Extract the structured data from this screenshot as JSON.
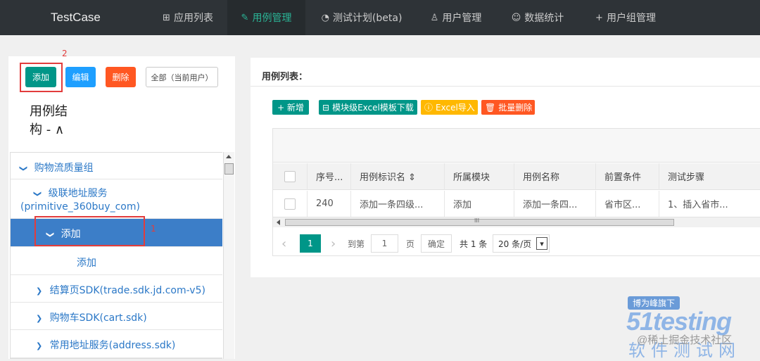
{
  "topnav": {
    "brand": "TestCase",
    "items": [
      {
        "icon": "⊞",
        "label": "应用列表"
      },
      {
        "icon": "✎",
        "label": "用例管理"
      },
      {
        "icon": "◔",
        "label": "测试计划(beta)"
      },
      {
        "icon": "♙",
        "label": "用户管理"
      },
      {
        "icon": "☺",
        "label": "数据统计"
      },
      {
        "icon": "+",
        "label": "用户组管理"
      }
    ]
  },
  "left": {
    "buttons": {
      "add": "添加",
      "edit": "编辑",
      "delete": "删除",
      "all": "全部（当前用户）"
    },
    "annotation_2": "2",
    "annotation_1": "1",
    "tree_title_line1": "用例结",
    "tree_title_line2": "构 - ∧",
    "tree": [
      {
        "label": "购物流质量组",
        "chev": "❯"
      },
      {
        "label": "级联地址服务",
        "label2": "(primitive_360buy_com)",
        "chev": "❯"
      },
      {
        "label": "添加",
        "chev": "❯"
      },
      {
        "label": "添加",
        "chev": ""
      },
      {
        "label": "结算页SDK(trade.sdk.jd.com-v5)",
        "chev": "❯"
      },
      {
        "label": "购物车SDK(cart.sdk)",
        "chev": "❯"
      },
      {
        "label": "常用地址服务(address.sdk)",
        "chev": "❯"
      }
    ]
  },
  "main": {
    "title": "用例列表：",
    "toolbar": {
      "new": "+ 新增",
      "template": "模块级Excel模板下载",
      "import": "Excel导入",
      "batch_delete": "批量删除"
    },
    "columns": [
      "序号...",
      "用例标识名 ⇕",
      "所属模块",
      "用例名称",
      "前置条件",
      "测试步骤"
    ],
    "rows": [
      [
        "240",
        "添加一条四级...",
        "添加",
        "添加一条四...",
        "省市区...",
        "1、插入省市..."
      ]
    ],
    "hscroll_mark": "III",
    "pager": {
      "prev": "‹",
      "current": "1",
      "next": "›",
      "goto": "到第",
      "page_input": "1",
      "page_unit": "页",
      "confirm": "确定",
      "total": "共 1 条",
      "page_size": "20 条/页",
      "dropdown_arrow": "▾"
    }
  },
  "watermark": {
    "badge": "博为峰旗下",
    "brand": "51testing",
    "site": "软件测试网",
    "community": "@稀土掘金技术社区"
  },
  "colors": {
    "nav_bg": "#2e3337",
    "accent": "#009688",
    "blue": "#1e9fff",
    "orange": "#ff5722",
    "yellow": "#ffb800",
    "selected": "#3c7ec8",
    "annotation": "#e23c3c"
  }
}
